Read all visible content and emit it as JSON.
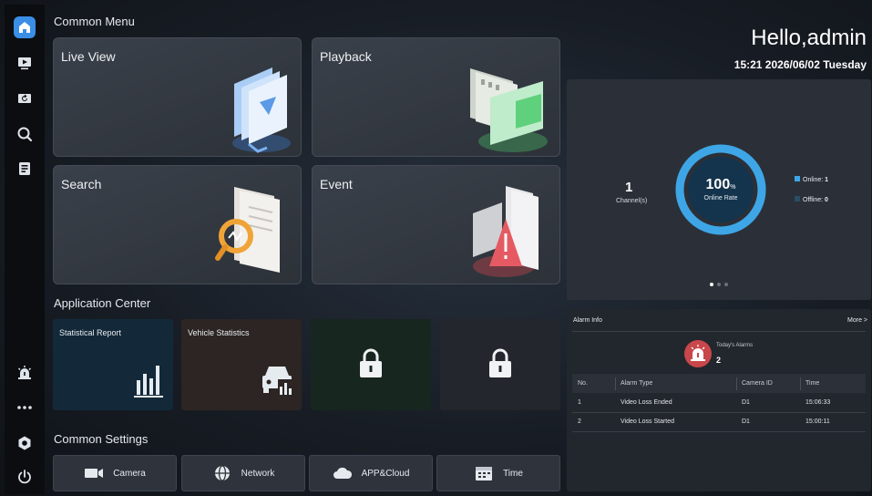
{
  "sidebar": {
    "items": [
      {
        "icon": "home-icon",
        "active": true
      },
      {
        "icon": "live-view-icon"
      },
      {
        "icon": "playback-icon"
      },
      {
        "icon": "search-icon"
      },
      {
        "icon": "event-list-icon"
      }
    ],
    "bottom": [
      {
        "icon": "alarm-icon"
      },
      {
        "icon": "more-icon"
      },
      {
        "icon": "settings-hexagon-icon"
      },
      {
        "icon": "power-icon"
      }
    ]
  },
  "common_menu": {
    "title": "Common Menu",
    "tiles": [
      {
        "label": "Live View"
      },
      {
        "label": "Playback"
      },
      {
        "label": "Search"
      },
      {
        "label": "Event"
      }
    ]
  },
  "app_center": {
    "title": "Application Center",
    "cards": [
      {
        "label": "Statistical Report",
        "icon": "bar-chart-icon",
        "color": "#13293a"
      },
      {
        "label": "Vehicle Statistics",
        "icon": "vehicle-stats-icon",
        "color": "#2c2523"
      },
      {
        "label": "",
        "icon": "lock-icon",
        "color": "#17261f"
      },
      {
        "label": "",
        "icon": "lock-icon",
        "color": "#23262c"
      }
    ]
  },
  "common_settings": {
    "title": "Common Settings",
    "buttons": [
      {
        "label": "Camera",
        "icon": "camera-icon"
      },
      {
        "label": "Network",
        "icon": "network-icon"
      },
      {
        "label": "APP&Cloud",
        "icon": "cloud-icon"
      },
      {
        "label": "Time",
        "icon": "calendar-icon"
      }
    ]
  },
  "header": {
    "greeting": "Hello,admin",
    "datetime": "15:21 2026/06/02 Tuesday"
  },
  "status": {
    "channels_value": "1",
    "channels_label": "Channel(s)",
    "online_rate_value": "100",
    "online_rate_unit": "%",
    "online_rate_label": "Online Rate",
    "online_rate_fraction": 1.0,
    "legend": [
      {
        "label": "Online: ",
        "value": "1",
        "color": "#3ea6e6"
      },
      {
        "label": "Offline: ",
        "value": "0",
        "color": "#2c4d66"
      }
    ],
    "pager_dots": 3,
    "pager_active": 0
  },
  "alarm": {
    "title": "Alarm Info",
    "more": "More >",
    "today_label": "Today's Alarms",
    "today_count": "2",
    "columns": [
      "No.",
      "Alarm Type",
      "Camera ID",
      "Time"
    ],
    "rows": [
      [
        "1",
        "Video Loss Ended",
        "D1",
        "15:06:33"
      ],
      [
        "2",
        "Video Loss Started",
        "D1",
        "15:00:11"
      ]
    ]
  },
  "colors": {
    "accent": "#3a8ee6",
    "alarm": "#c8474a"
  }
}
